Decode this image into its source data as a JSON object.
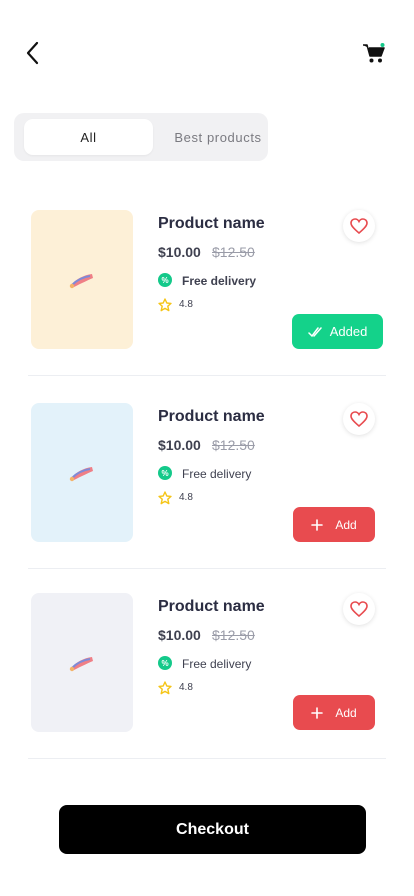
{
  "header": {
    "back_icon": "chevron-left-icon",
    "cart_icon": "cart-icon",
    "cart_badge_color": "#14c98a"
  },
  "tabs": [
    {
      "label": "All",
      "active": true
    },
    {
      "label": "Best products",
      "active": false
    }
  ],
  "products": [
    {
      "name": "Product name",
      "price": "$10.00",
      "old_price": "$12.50",
      "delivery": "Free delivery",
      "rating": "4.8",
      "button_label": "Added",
      "button_state": "added",
      "thumb_color": "#fdf0d7"
    },
    {
      "name": "Product name",
      "price": "$10.00",
      "old_price": "$12.50",
      "delivery": "Free delivery",
      "rating": "4.8",
      "button_label": "Add",
      "button_state": "add",
      "thumb_color": "#e3f2fa"
    },
    {
      "name": "Product name",
      "price": "$10.00",
      "old_price": "$12.50",
      "delivery": "Free delivery",
      "rating": "4.8",
      "button_label": "Add",
      "button_state": "add",
      "thumb_color": "#f0f1f6"
    }
  ],
  "delivery_badge_symbol": "%",
  "checkout_label": "Checkout",
  "colors": {
    "added": "#14d28a",
    "add": "#e84b4f",
    "heart": "#e84b4f",
    "star": "#f5c518"
  }
}
